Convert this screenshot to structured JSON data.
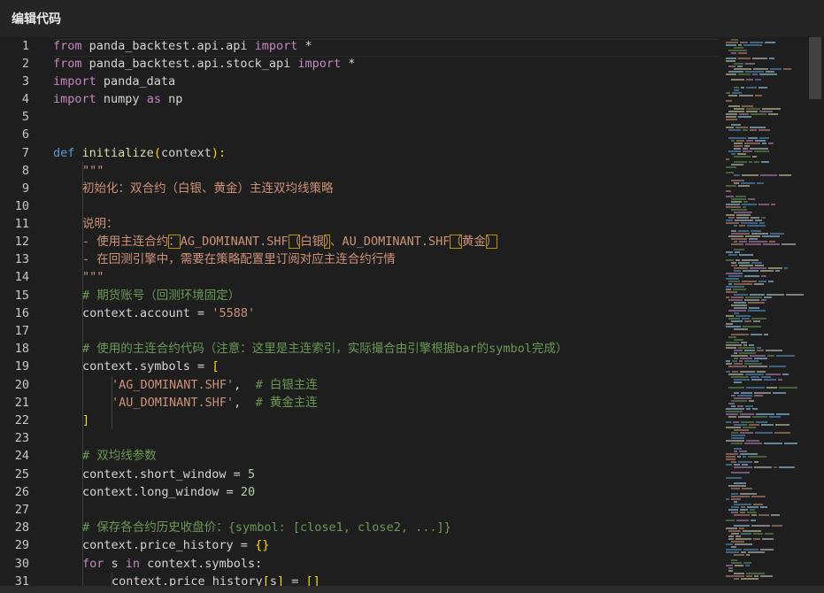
{
  "window": {
    "title": "编辑代码"
  },
  "editor": {
    "line_numbers": [
      "1",
      "2",
      "3",
      "4",
      "5",
      "6",
      "7",
      "8",
      "9",
      "10",
      "11",
      "12",
      "13",
      "14",
      "15",
      "16",
      "17",
      "18",
      "19",
      "20",
      "21",
      "22",
      "23",
      "24",
      "25",
      "26",
      "27",
      "28",
      "29",
      "30",
      "31"
    ]
  },
  "code": {
    "l1": [
      "from",
      " panda_backtest.api.api ",
      "import",
      " *"
    ],
    "l2": [
      "from",
      " panda_backtest.api.stock_api ",
      "import",
      " *"
    ],
    "l3": [
      "import",
      " panda_data"
    ],
    "l4": [
      "import",
      " numpy ",
      "as",
      " np"
    ],
    "l7": [
      "def",
      " ",
      "initialize",
      "(",
      "context",
      "):"
    ],
    "l8": "\"\"\"",
    "l9": "初始化：双合约（白银、黄金）主连双均线策略",
    "l11": "说明：",
    "l12": [
      "- 使用主连合约",
      "：",
      "AG_DOMINANT.SHF",
      "（",
      "白银",
      "）",
      "、AU_DOMINANT.SHF",
      "（",
      "黄金",
      "）"
    ],
    "l13": "- 在回测引擎中，需要在策略配置里订阅对应主连合约行情",
    "l14": "\"\"\"",
    "l15": "# 期货账号（回测环境固定）",
    "l16": [
      "context.account = ",
      "'5588'"
    ],
    "l18": "# 使用的主连合约代码（注意：这里是主连索引，实际撮合由引擎根据bar的symbol完成）",
    "l19": [
      "context.symbols = ",
      "["
    ],
    "l20": [
      "'AG_DOMINANT.SHF'",
      ",  ",
      "# 白银主连"
    ],
    "l21": [
      "'AU_DOMINANT.SHF'",
      ",  ",
      "# 黄金主连"
    ],
    "l22": "]",
    "l24": "# 双均线参数",
    "l25": [
      "context.short_window = ",
      "5"
    ],
    "l26": [
      "context.long_window = ",
      "20"
    ],
    "l28": "# 保存各合约历史收盘价：{symbol: [close1, close2, ...]}",
    "l29": [
      "context.price_history = ",
      "{}"
    ],
    "l30": [
      "for",
      " s ",
      "in",
      " context.symbols:"
    ],
    "l31": [
      "context.price_history",
      "[",
      "s",
      "]",
      " = ",
      "[]"
    ]
  },
  "colors": {
    "background": "#1e1e1e",
    "keyword": "#569cd6",
    "control": "#c586c0",
    "function": "#dcdcaa",
    "string": "#ce9178",
    "number": "#b5cea8",
    "comment": "#6a9955"
  }
}
